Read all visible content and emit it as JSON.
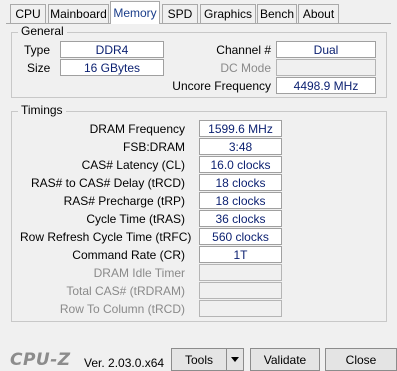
{
  "tabs": [
    "CPU",
    "Mainboard",
    "Memory",
    "SPD",
    "Graphics",
    "Bench",
    "About"
  ],
  "general": {
    "title": "General",
    "type_label": "Type",
    "type_value": "DDR4",
    "size_label": "Size",
    "size_value": "16 GBytes",
    "channel_label": "Channel #",
    "channel_value": "Dual",
    "dc_mode_label": "DC Mode",
    "dc_mode_value": "",
    "uncore_label": "Uncore Frequency",
    "uncore_value": "4498.9 MHz"
  },
  "timings": {
    "title": "Timings",
    "rows": [
      {
        "label": "DRAM Frequency",
        "value": "1599.6 MHz"
      },
      {
        "label": "FSB:DRAM",
        "value": "3:48"
      },
      {
        "label": "CAS# Latency (CL)",
        "value": "16.0 clocks"
      },
      {
        "label": "RAS# to CAS# Delay (tRCD)",
        "value": "18 clocks"
      },
      {
        "label": "RAS# Precharge (tRP)",
        "value": "18 clocks"
      },
      {
        "label": "Cycle Time (tRAS)",
        "value": "36 clocks"
      },
      {
        "label": "Row Refresh Cycle Time (tRFC)",
        "value": "560 clocks"
      },
      {
        "label": "Command Rate (CR)",
        "value": "1T"
      },
      {
        "label": "DRAM Idle Timer",
        "value": ""
      },
      {
        "label": "Total CAS# (tRDRAM)",
        "value": ""
      },
      {
        "label": "Row To Column (tRCD)",
        "value": ""
      }
    ]
  },
  "footer": {
    "logo": "CPU-Z",
    "version": "Ver. 2.03.0.x64",
    "tools_label": "Tools",
    "validate_label": "Validate",
    "close_label": "Close"
  }
}
